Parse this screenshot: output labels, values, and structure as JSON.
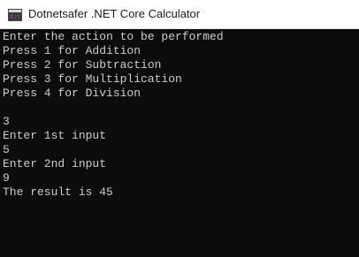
{
  "window": {
    "title": "Dotnetsafer .NET Core Calculator",
    "icon": "console-app-icon"
  },
  "console": {
    "lines": [
      "Enter the action to be performed",
      "Press 1 for Addition",
      "Press 2 for Subtraction",
      "Press 3 for Multiplication",
      "Press 4 for Division",
      "",
      "3",
      "Enter 1st input",
      "5",
      "Enter 2nd input",
      "9",
      "The result is 45"
    ]
  },
  "colors": {
    "console_background": "#0c0c0c",
    "console_text": "#cccccc",
    "titlebar_background": "#ffffff"
  }
}
